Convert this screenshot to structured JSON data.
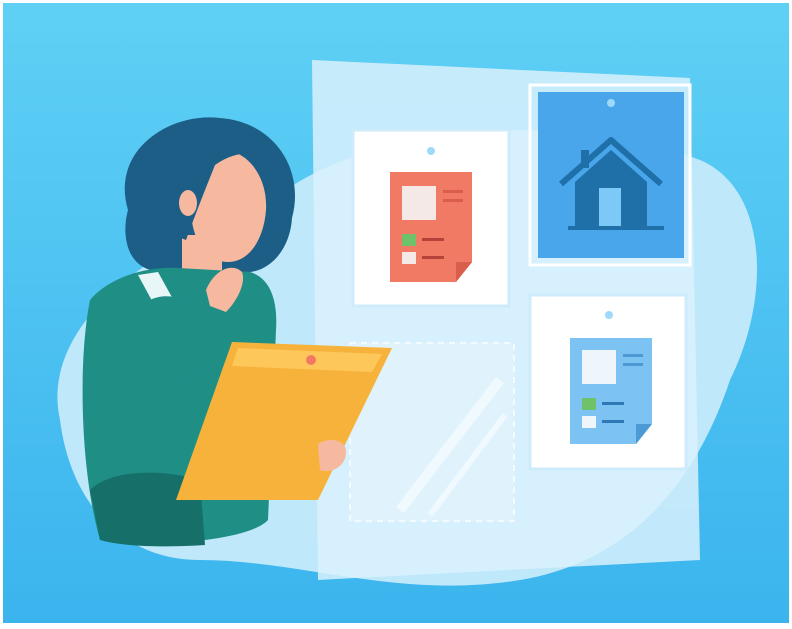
{
  "illustration": {
    "icons": [
      "person-icon",
      "clipboard-icon",
      "document-icon",
      "house-icon",
      "document-icon",
      "empty-card-icon"
    ]
  },
  "colors": {
    "background_top": "#5fd0f5",
    "background_bottom": "#3bb4ee",
    "blob": "#bfe8fb",
    "panel": "#d9f1fd",
    "card": "#ffffff",
    "card_border": "#cdebfb",
    "house_card": "#4aa6ea",
    "house": "#1f6fa8",
    "doc_red": "#f07a63",
    "doc_red_fold": "#d95e4b",
    "doc_blue": "#7cc2f2",
    "doc_blue_fold": "#4b9ad6",
    "accent_green": "#6fc26a",
    "hair": "#1d5e86",
    "skin": "#f6b89e",
    "sweater": "#1f8f86",
    "sweater_dark": "#176f6a",
    "collar": "#e9f6f8",
    "clipboard": "#f7b23b",
    "clipboard_light": "#ffd166",
    "pin": "#9fd9f9"
  }
}
